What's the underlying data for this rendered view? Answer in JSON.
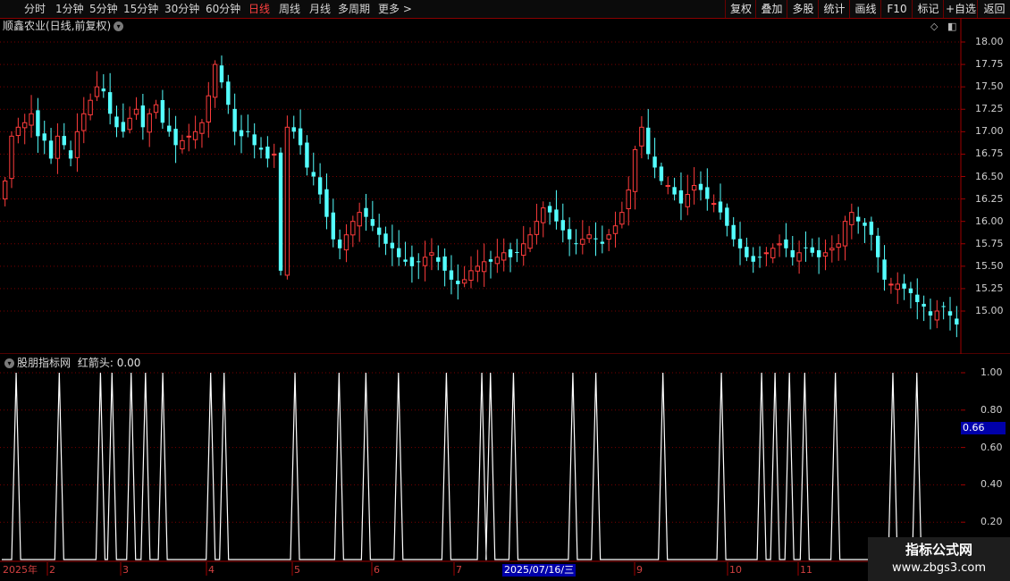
{
  "toolbar": {
    "periods": [
      "分时",
      "1分钟",
      "5分钟",
      "15分钟",
      "30分钟",
      "60分钟",
      "日线",
      "周线",
      "月线",
      "多周期",
      "更多 >"
    ],
    "active_period": "日线",
    "actions": [
      "复权",
      "叠加",
      "多股",
      "统计",
      "画线",
      "F10",
      "标记",
      "+自选",
      "返回"
    ]
  },
  "main_panel": {
    "title": "顺鑫农业(日线,前复权)",
    "up_color": "#ff3c3c",
    "down_color": "#54ffff"
  },
  "indicator_panel": {
    "title": "股朋指标网",
    "value_label": "红箭头: 0.00",
    "current_marker": "0.66",
    "line_color": "#ffffff"
  },
  "date_axis": {
    "year_label": "2025年",
    "months": [
      "2",
      "3",
      "4",
      "5",
      "6",
      "7",
      "9",
      "10",
      "11"
    ],
    "crosshair_date": "2025/07/16/三"
  },
  "watermark": {
    "line1": "指标公式网",
    "line2": "www.zbgs3.com"
  },
  "chart_data": [
    {
      "type": "candlestick",
      "y_ticks": [
        "18.00",
        "17.75",
        "17.50",
        "17.25",
        "17.00",
        "16.75",
        "16.50",
        "16.25",
        "16.00",
        "15.75",
        "15.50",
        "15.25",
        "15.00"
      ],
      "ylim": [
        14.75,
        18.25
      ],
      "grid": true,
      "close_series": [
        16.45,
        16.95,
        17.05,
        17.1,
        17.2,
        16.95,
        16.9,
        16.7,
        16.95,
        16.85,
        16.7,
        17.0,
        17.2,
        17.35,
        17.5,
        17.45,
        17.2,
        17.05,
        17.0,
        17.15,
        17.25,
        17.05,
        17.2,
        17.3,
        17.1,
        17.0,
        16.85,
        16.9,
        16.95,
        17.0,
        17.1,
        17.4,
        17.75,
        17.55,
        17.3,
        17.0,
        16.95,
        17.0,
        16.85,
        16.8,
        16.7,
        16.75,
        15.45,
        17.05,
        17.0,
        16.85,
        16.6,
        16.5,
        16.3,
        16.05,
        15.8,
        15.7,
        15.85,
        16.0,
        16.1,
        16.05,
        15.95,
        15.85,
        15.75,
        15.7,
        15.6,
        15.55,
        15.5,
        15.55,
        15.6,
        15.65,
        15.55,
        15.45,
        15.35,
        15.3,
        15.35,
        15.45,
        15.5,
        15.55,
        15.55,
        15.6,
        15.65,
        15.6,
        15.65,
        15.75,
        15.85,
        16.0,
        16.15,
        16.1,
        16.0,
        15.9,
        15.8,
        15.75,
        15.8,
        15.85,
        15.8,
        15.75,
        15.85,
        15.95,
        16.1,
        16.35,
        16.8,
        17.05,
        16.75,
        16.6,
        16.45,
        16.4,
        16.3,
        16.2,
        16.3,
        16.4,
        16.35,
        16.25,
        16.2,
        16.1,
        15.95,
        15.8,
        15.7,
        15.6,
        15.55,
        15.6,
        15.65,
        15.7,
        15.75,
        15.7,
        15.6,
        15.65,
        15.7,
        15.65,
        15.6,
        15.65,
        15.7,
        15.75,
        16.0,
        16.1,
        16.0,
        15.95,
        15.85,
        15.6,
        15.35,
        15.3,
        15.3,
        15.25,
        15.2,
        15.1,
        15.05,
        14.95,
        15.0,
        15.05,
        14.95,
        14.85
      ],
      "candle_count": 146
    },
    {
      "type": "line",
      "y_ticks": [
        "1.00",
        "0.80",
        "0.60",
        "0.40",
        "0.20"
      ],
      "ylim": [
        0,
        1.05
      ],
      "grid": true,
      "spike_positions": [
        0.015,
        0.06,
        0.103,
        0.115,
        0.135,
        0.15,
        0.168,
        0.218,
        0.232,
        0.306,
        0.352,
        0.38,
        0.414,
        0.464,
        0.501,
        0.51,
        0.534,
        0.596,
        0.62,
        0.69,
        0.751,
        0.793,
        0.807,
        0.822,
        0.838,
        0.87,
        0.93,
        0.955
      ],
      "spike_value": 1.0,
      "base_value": 0.0
    }
  ]
}
